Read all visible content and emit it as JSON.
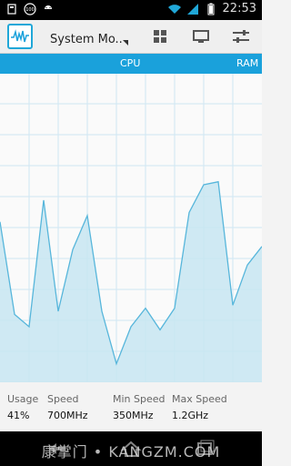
{
  "status_bar": {
    "time": "22:53",
    "icons_left": [
      "sd-card-icon",
      "circle-100-icon",
      "android-icon"
    ],
    "icons_right": [
      "wifi-icon",
      "signal-icon",
      "battery-icon"
    ]
  },
  "action_bar": {
    "title": "System Mo..",
    "buttons": [
      "grid-icon",
      "monitor-icon",
      "sliders-icon"
    ]
  },
  "tabs": [
    "CPU",
    "RAM"
  ],
  "chart_data": {
    "type": "area",
    "title": "",
    "xlabel": "",
    "ylabel": "",
    "ylim": [
      0,
      100
    ],
    "x": [
      0,
      1,
      2,
      3,
      4,
      5,
      6,
      7,
      8,
      9,
      10,
      11,
      12,
      13,
      14,
      15,
      16,
      17,
      18
    ],
    "values": [
      52,
      22,
      18,
      59,
      23,
      43,
      54,
      23,
      6,
      18,
      24,
      17,
      24,
      55,
      64,
      65,
      25,
      38,
      44
    ],
    "grid": true,
    "colors": {
      "fill": "#c7e5f1",
      "line": "#57b6db",
      "grid": "#cfe7f3"
    }
  },
  "stats": {
    "usage": {
      "label": "Usage",
      "value": "41%"
    },
    "speed": {
      "label": "Speed",
      "value": "700MHz"
    },
    "min_speed": {
      "label": "Min Speed",
      "value": "350MHz"
    },
    "max_speed": {
      "label": "Max Speed",
      "value": "1.2GHz"
    }
  },
  "watermark": {
    "text": "康掌门 • KANGZM.COM"
  },
  "nav_icons": [
    "back-icon",
    "home-icon",
    "recent-icon"
  ]
}
